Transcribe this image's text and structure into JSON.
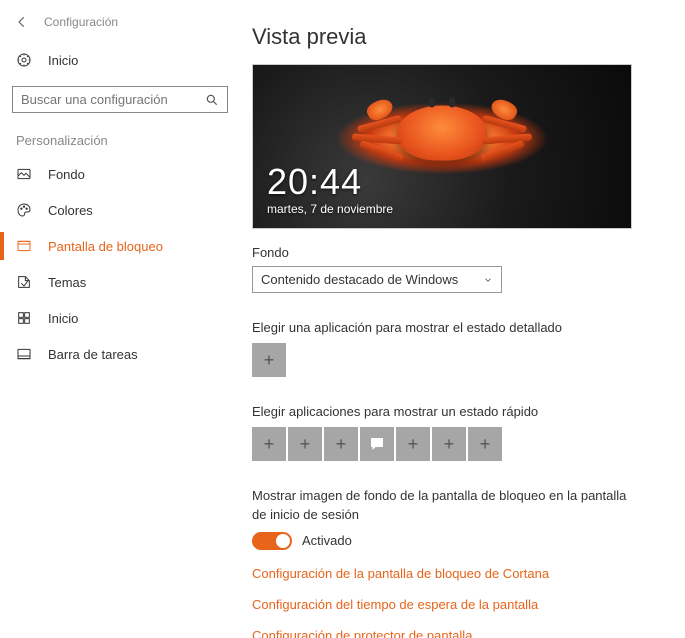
{
  "header": {
    "app_title": "Configuración"
  },
  "sidebar": {
    "home_label": "Inicio",
    "search_placeholder": "Buscar una configuración",
    "section_label": "Personalización",
    "items": [
      {
        "label": "Fondo"
      },
      {
        "label": "Colores"
      },
      {
        "label": "Pantalla de bloqueo"
      },
      {
        "label": "Temas"
      },
      {
        "label": "Inicio"
      },
      {
        "label": "Barra de tareas"
      }
    ]
  },
  "main": {
    "title": "Vista previa",
    "preview_time": "20:44",
    "preview_date": "martes, 7 de noviembre",
    "background_label": "Fondo",
    "background_selected": "Contenido destacado de Windows",
    "detailed_app_label": "Elegir una aplicación para mostrar el estado detallado",
    "quick_apps_label": "Elegir aplicaciones para mostrar un estado rápido",
    "show_image_label": "Mostrar imagen de fondo de la pantalla de bloqueo en la pantalla de inicio de sesión",
    "toggle_state": "Activado",
    "links": [
      "Configuración de la pantalla de bloqueo de Cortana",
      "Configuración del tiempo de espera de la pantalla",
      "Configuración de protector de pantalla"
    ]
  }
}
